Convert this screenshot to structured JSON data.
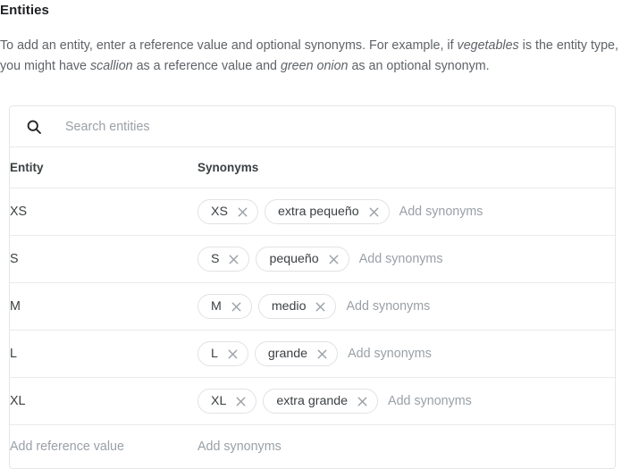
{
  "header": {
    "title": "Entities",
    "description_parts": [
      {
        "text": "To add an entity, enter a reference value and optional synonyms. For example, if ",
        "italic": false
      },
      {
        "text": "vegetables",
        "italic": true
      },
      {
        "text": " is the entity type, you might have ",
        "italic": false
      },
      {
        "text": "scallion",
        "italic": true
      },
      {
        "text": " as a reference value and ",
        "italic": false
      },
      {
        "text": "green onion",
        "italic": true
      },
      {
        "text": " as an optional synonym.",
        "italic": false
      }
    ],
    "description_plain": "To add an entity, enter a reference value and optional synonyms. For example, if vegetables is the entity type, you might have scallion as a reference value and green onion as an optional synonym."
  },
  "search": {
    "icon": "search-icon",
    "placeholder": "Search entities",
    "value": ""
  },
  "table": {
    "columns": [
      {
        "key": "entity",
        "label": "Entity"
      },
      {
        "key": "synonyms",
        "label": "Synonyms"
      }
    ],
    "rows": [
      {
        "entity": "XS",
        "chips": [
          {
            "label": "XS",
            "remove_icon": "close-icon"
          },
          {
            "label": "extra pequeño",
            "remove_icon": "close-icon"
          }
        ],
        "add_synonyms_placeholder": "Add synonyms"
      },
      {
        "entity": "S",
        "chips": [
          {
            "label": "S",
            "remove_icon": "close-icon"
          },
          {
            "label": "pequeño",
            "remove_icon": "close-icon"
          }
        ],
        "add_synonyms_placeholder": "Add synonyms"
      },
      {
        "entity": "M",
        "chips": [
          {
            "label": "M",
            "remove_icon": "close-icon"
          },
          {
            "label": "medio",
            "remove_icon": "close-icon"
          }
        ],
        "add_synonyms_placeholder": "Add synonyms"
      },
      {
        "entity": "L",
        "chips": [
          {
            "label": "L",
            "remove_icon": "close-icon"
          },
          {
            "label": "grande",
            "remove_icon": "close-icon"
          }
        ],
        "add_synonyms_placeholder": "Add synonyms"
      },
      {
        "entity": "XL",
        "chips": [
          {
            "label": "XL",
            "remove_icon": "close-icon"
          },
          {
            "label": "extra grande",
            "remove_icon": "close-icon"
          }
        ],
        "add_synonyms_placeholder": "Add synonyms"
      }
    ],
    "add_row": {
      "reference_placeholder": "Add reference value",
      "synonyms_placeholder": "Add synonyms"
    }
  },
  "colors": {
    "text_primary": "#202124",
    "text_secondary": "#3c4043",
    "text_muted": "#9aa0a6",
    "border": "#e8eaed",
    "chip_border": "#e0e2e5",
    "background": "#ffffff"
  }
}
